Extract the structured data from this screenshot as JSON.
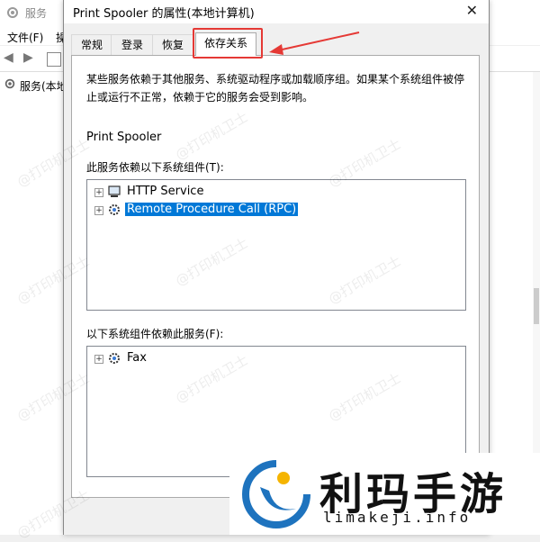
{
  "background_window": {
    "title": "服务",
    "menu": [
      "文件(F)",
      "操"
    ],
    "tree_item": "服务(本地"
  },
  "dialog": {
    "title": "Print Spooler 的属性(本地计算机)",
    "close_glyph": "✕",
    "tabs": [
      "常规",
      "登录",
      "恢复",
      "依存关系"
    ],
    "active_tab": "依存关系",
    "description": "某些服务依赖于其他服务、系统驱动程序或加载顺序组。如果某个系统组件被停止或运行不正常，依赖于它的服务会受到影响。",
    "service_name": "Print Spooler",
    "depends_on_label": "此服务依赖以下系统组件(T):",
    "depends_on": [
      {
        "label": "HTTP Service",
        "icon": "network-monitor-icon",
        "selected": false
      },
      {
        "label": "Remote Procedure Call (RPC)",
        "icon": "service-gear-icon",
        "selected": true
      }
    ],
    "dependents_label": "以下系统组件依赖此服务(F):",
    "dependents": [
      {
        "label": "Fax",
        "icon": "service-gear-icon",
        "selected": false
      }
    ],
    "expander_glyph": "+"
  },
  "watermark": "@打印机卫士",
  "logo": {
    "name_cn": "利玛手游",
    "domain": "limakeji.info"
  },
  "colors": {
    "annotation_red": "#e53935",
    "selection_blue": "#0078d7",
    "logo_blue": "#1e73be"
  }
}
